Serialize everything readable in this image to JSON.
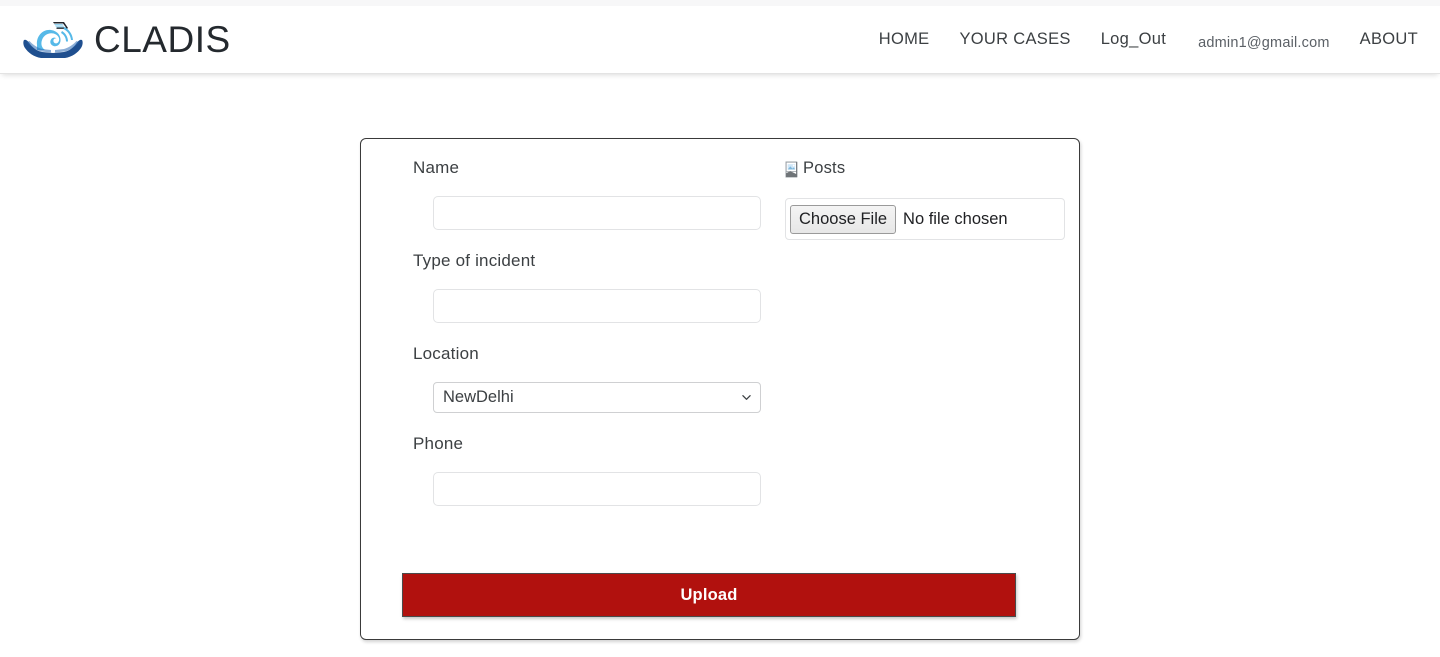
{
  "header": {
    "brand": {
      "name": "CLADIS",
      "logo_icon": "hands-holding-wave-house-logo"
    },
    "nav": [
      {
        "label": "HOME",
        "name": "nav-link-home"
      },
      {
        "label": "YOUR CASES",
        "name": "nav-link-your-cases"
      },
      {
        "label": "Log_Out",
        "name": "nav-link-logout"
      }
    ],
    "user_email": "admin1@gmail.com",
    "about_label": "ABOUT"
  },
  "form": {
    "fields": {
      "name": {
        "label": "Name",
        "value": "",
        "placeholder": ""
      },
      "incident": {
        "label": "Type of incident",
        "value": "",
        "placeholder": ""
      },
      "location": {
        "label": "Location",
        "value": "NewDelhi",
        "options": [
          "NewDelhi"
        ],
        "chevron_icon": "chevron-down-icon"
      },
      "phone": {
        "label": "Phone",
        "value": "",
        "placeholder": ""
      }
    },
    "image_preview": {
      "alt_text": "Posts",
      "icon": "broken-image-icon"
    },
    "file_input": {
      "button_label": "Choose File",
      "status_text": "No file chosen"
    },
    "submit": {
      "label": "Upload",
      "color": "#b1110e"
    }
  },
  "colors": {
    "accent_red": "#b1110e",
    "logo_dark_blue": "#1f4f8f",
    "logo_light_blue": "#56b9e8",
    "text": "#3c4043",
    "border_light": "#e2e3e5"
  }
}
